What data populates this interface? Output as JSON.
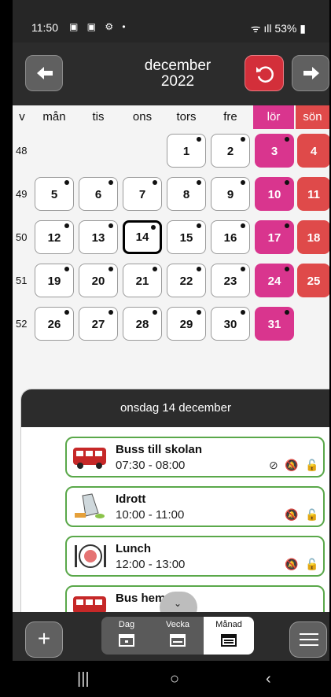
{
  "status_bar": {
    "time": "11:50",
    "battery": "53%"
  },
  "header": {
    "month": "december",
    "year": "2022"
  },
  "weekdays": [
    "v",
    "mån",
    "tis",
    "ons",
    "tors",
    "fre",
    "lör",
    "sön"
  ],
  "weeks": [
    {
      "number": "48",
      "days": [
        "",
        "",
        "",
        "1",
        "2",
        "3",
        "4"
      ]
    },
    {
      "number": "49",
      "days": [
        "5",
        "6",
        "7",
        "8",
        "9",
        "10",
        "11"
      ]
    },
    {
      "number": "50",
      "days": [
        "12",
        "13",
        "14",
        "15",
        "16",
        "17",
        "18"
      ]
    },
    {
      "number": "51",
      "days": [
        "19",
        "20",
        "21",
        "22",
        "23",
        "24",
        "25"
      ]
    },
    {
      "number": "52",
      "days": [
        "26",
        "27",
        "28",
        "29",
        "30",
        "31",
        ""
      ]
    }
  ],
  "today": "14",
  "colors": {
    "saturday": "#d9358e",
    "sunday": "#df4a4a",
    "event_border": "#5aa84a",
    "dark": "#2c2c2c"
  },
  "day_panel": {
    "title": "onsdag 14 december",
    "events": [
      {
        "title": "Buss till skolan",
        "time": "07:30 - 08:00",
        "icon": "bus-icon",
        "done": true
      },
      {
        "title": "Idrott",
        "time": "10:00 - 11:00",
        "icon": "gym-bag-icon",
        "done": false
      },
      {
        "title": "Lunch",
        "time": "12:00 - 13:00",
        "icon": "lunch-plate-icon",
        "done": false
      },
      {
        "title": "Bus hem",
        "time": "",
        "icon": "bus-icon",
        "done": false
      }
    ]
  },
  "view_tabs": [
    {
      "label": "Dag"
    },
    {
      "label": "Vecka"
    },
    {
      "label": "Månad"
    }
  ],
  "active_tab": "Månad"
}
